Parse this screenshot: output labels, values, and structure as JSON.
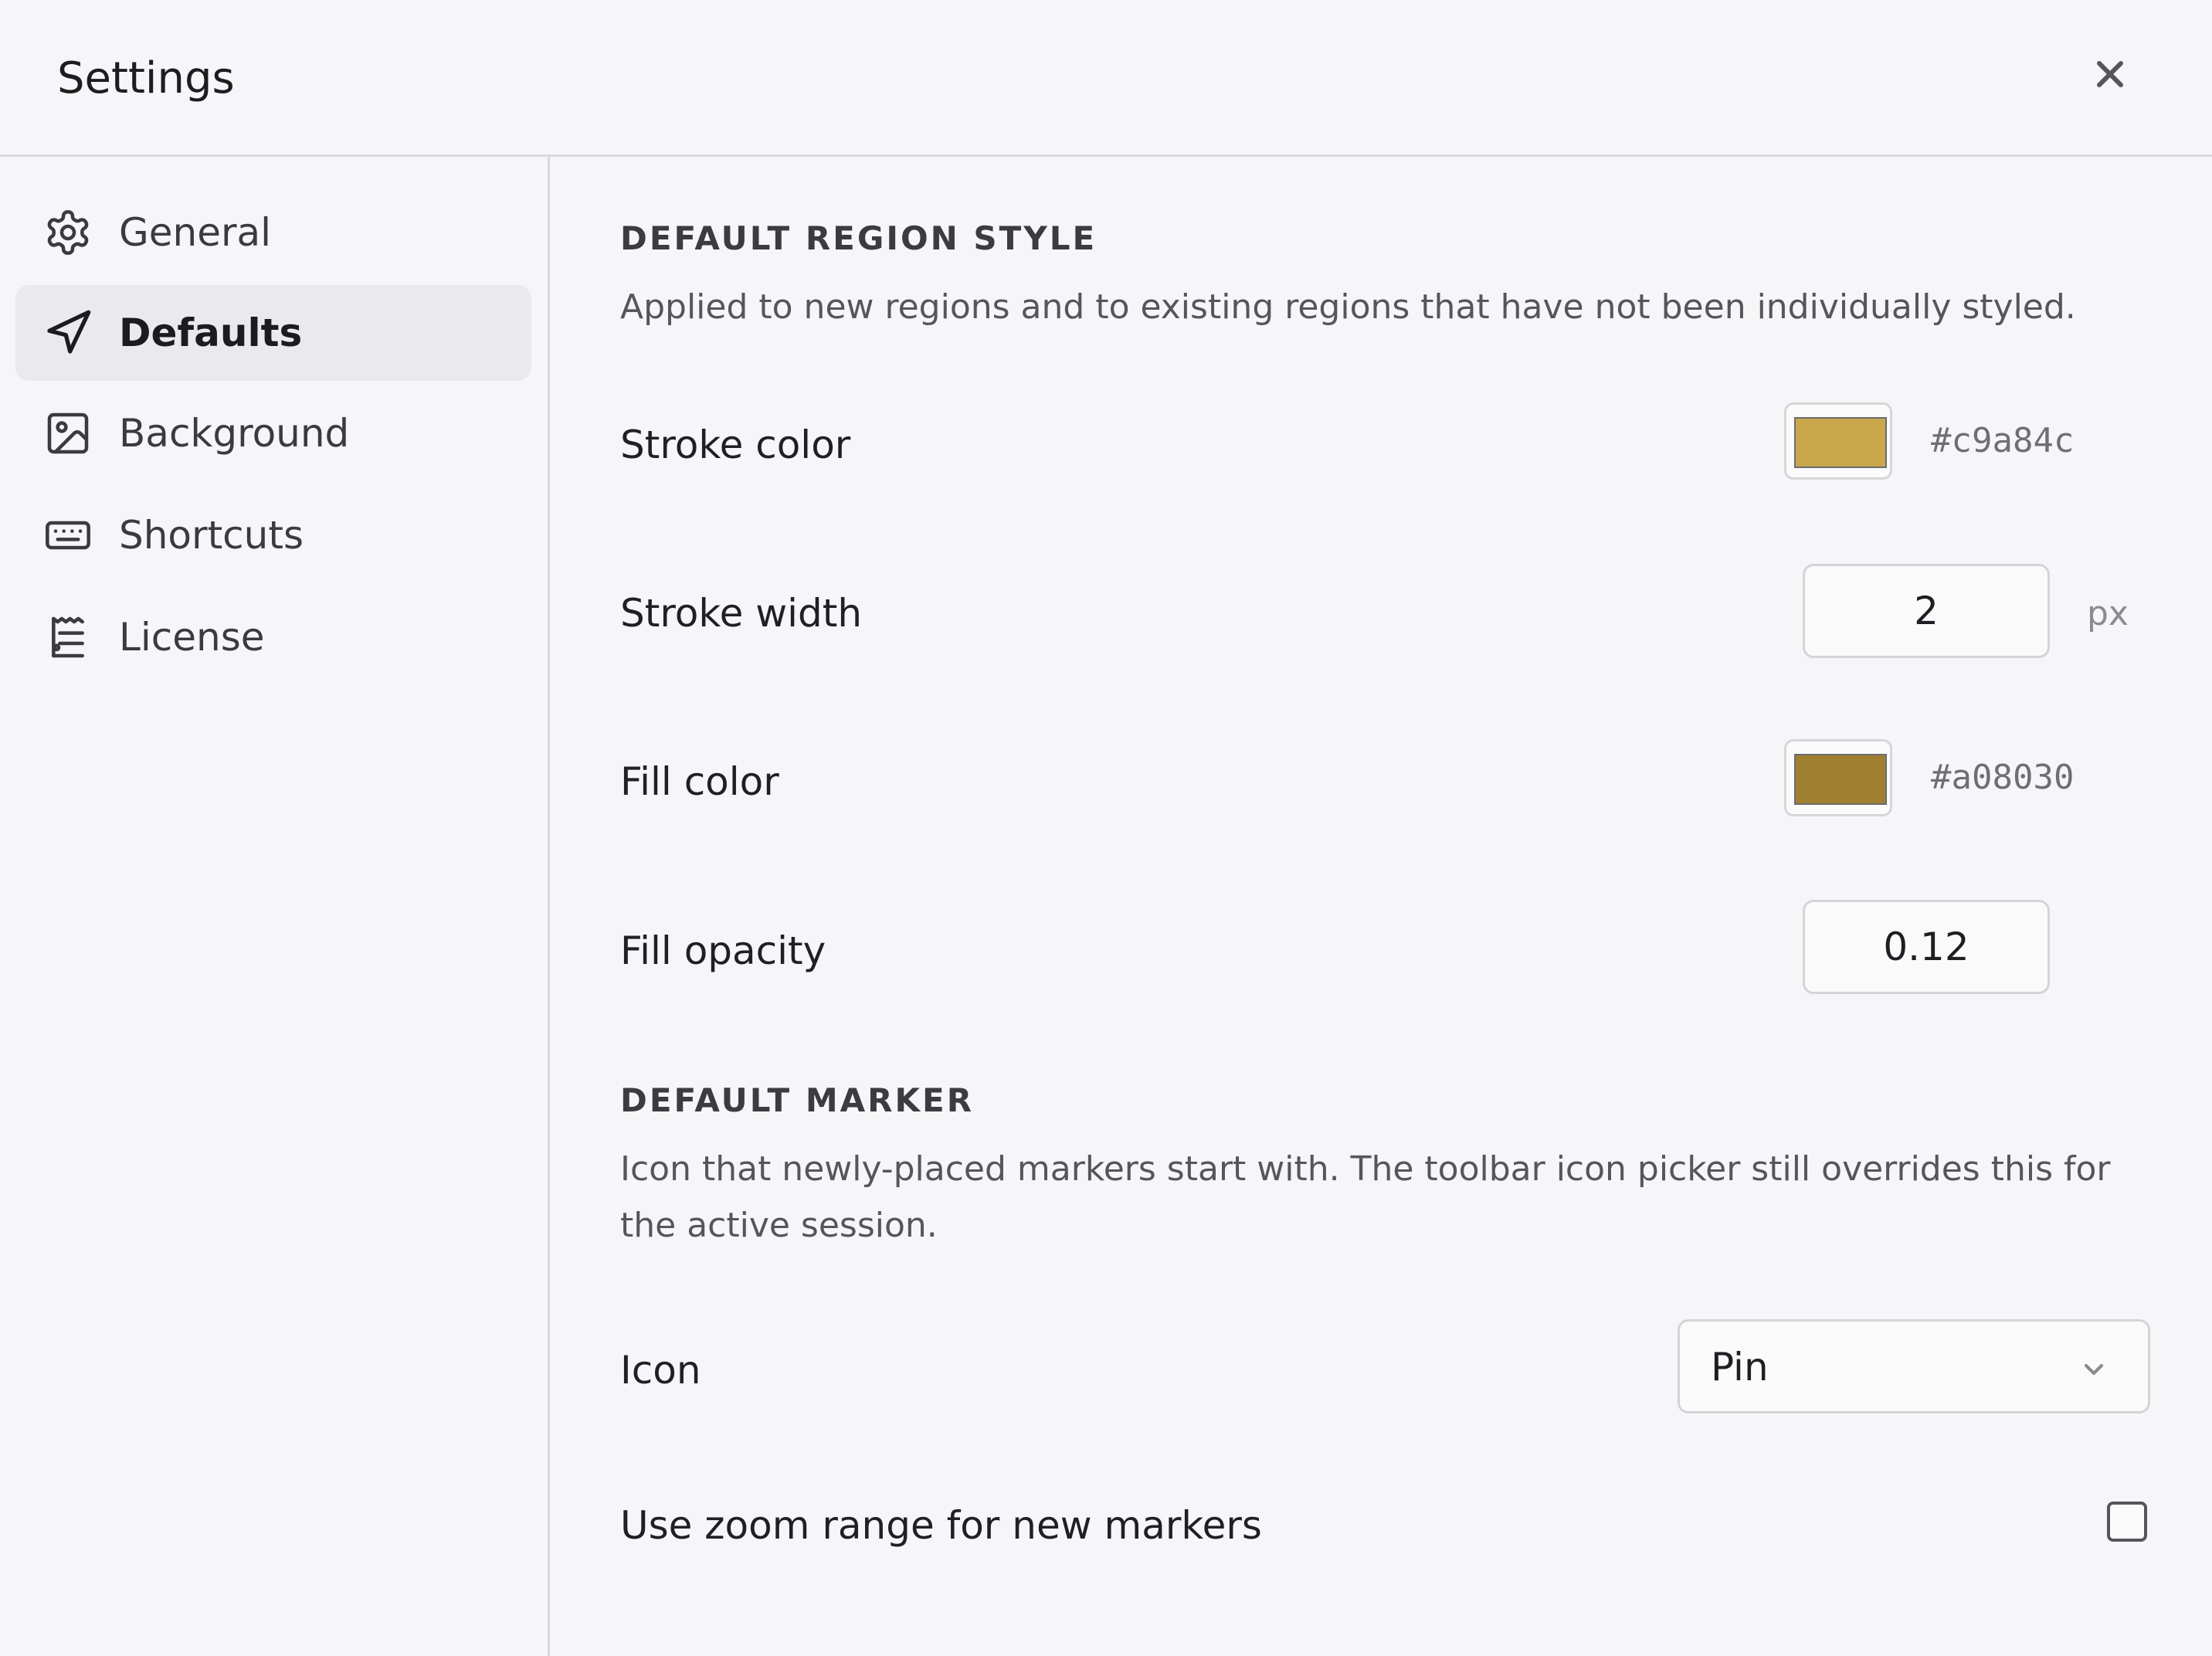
{
  "dialog": {
    "title": "Settings",
    "close_icon": "close-icon"
  },
  "sidebar": {
    "items": [
      {
        "label": "General",
        "icon": "gear-icon",
        "active": false
      },
      {
        "label": "Defaults",
        "icon": "navigation-arrow-icon",
        "active": true
      },
      {
        "label": "Background",
        "icon": "image-icon",
        "active": false
      },
      {
        "label": "Shortcuts",
        "icon": "keyboard-icon",
        "active": false
      },
      {
        "label": "License",
        "icon": "receipt-icon",
        "active": false
      }
    ]
  },
  "region_style": {
    "title": "DEFAULT REGION STYLE",
    "description": "Applied to new regions and to existing regions that have not been individually styled.",
    "stroke_color": {
      "label": "Stroke color",
      "value": "#c9a84c"
    },
    "stroke_width": {
      "label": "Stroke width",
      "value": "2",
      "unit": "px"
    },
    "fill_color": {
      "label": "Fill color",
      "value": "#a08030"
    },
    "fill_opacity": {
      "label": "Fill opacity",
      "value": "0.12"
    }
  },
  "marker": {
    "title": "DEFAULT MARKER",
    "description": "Icon that newly-placed markers start with. The toolbar icon picker still overrides this for the active session.",
    "icon": {
      "label": "Icon",
      "value": "Pin"
    },
    "zoom_range": {
      "label": "Use zoom range for new markers",
      "checked": false
    }
  }
}
